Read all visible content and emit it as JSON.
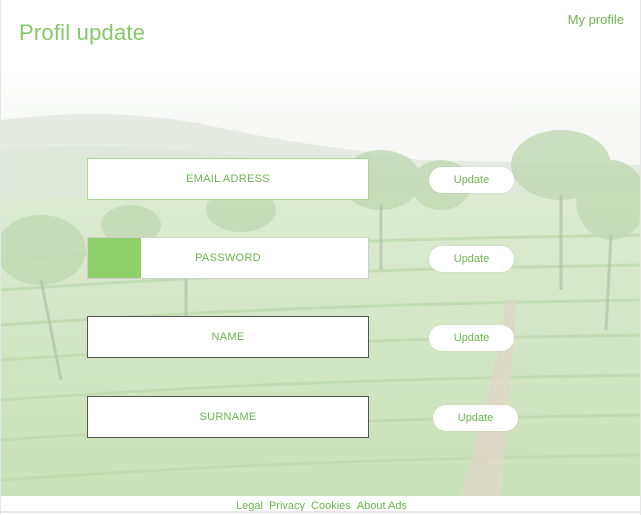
{
  "header": {
    "title": "Profil update",
    "my_profile_link": "My profile"
  },
  "form": {
    "email": {
      "placeholder": "EMAIL ADRESS",
      "button": "Update"
    },
    "password": {
      "placeholder": "PASSWORD",
      "button": "Update",
      "strength": 0.19
    },
    "name": {
      "placeholder": "NAME",
      "button": "Update"
    },
    "surname": {
      "placeholder": "SURNAME",
      "button": "Update"
    }
  },
  "footer": {
    "links": [
      "Legal",
      "Privacy",
      "Cookies",
      "About Ads"
    ]
  },
  "colors": {
    "accent": "#6cb54f",
    "title": "#86c96a",
    "strength_fill": "#8fd06a"
  }
}
